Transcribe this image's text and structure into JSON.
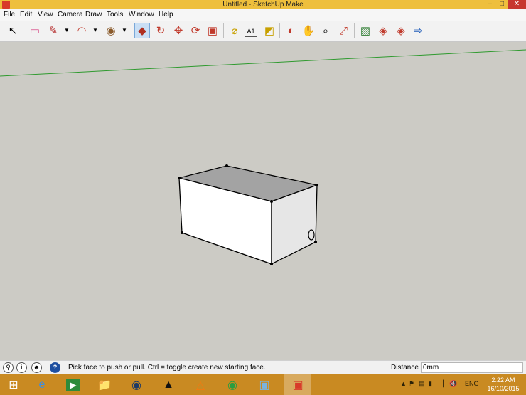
{
  "window": {
    "title": "Untitled - SketchUp Make",
    "minimize": "–",
    "maximize": "□",
    "close": "✕"
  },
  "menu": [
    "File",
    "Edit",
    "View",
    "Camera",
    "Draw",
    "Tools",
    "Window",
    "Help"
  ],
  "toolbar": {
    "tools": [
      {
        "icon": "select-arrow-icon",
        "glyph": "↖"
      },
      {
        "icon": "eraser-icon",
        "glyph": "▭"
      },
      {
        "icon": "pencil-line-icon",
        "glyph": "✎"
      },
      {
        "icon": "arc-icon",
        "glyph": "◠"
      },
      {
        "icon": "shape-circle-icon",
        "glyph": "◉"
      },
      {
        "icon": "push-pull-icon",
        "glyph": "◆"
      },
      {
        "icon": "follow-me-icon",
        "glyph": "↻"
      },
      {
        "icon": "move-icon",
        "glyph": "✥"
      },
      {
        "icon": "rotate-icon",
        "glyph": "⟳"
      },
      {
        "icon": "scale-icon",
        "glyph": "▣"
      },
      {
        "icon": "tape-measure-icon",
        "glyph": "⌀"
      },
      {
        "icon": "text-label-icon",
        "glyph": "A1"
      },
      {
        "icon": "paint-bucket-icon",
        "glyph": "◩"
      },
      {
        "icon": "orbit-icon",
        "glyph": "◐"
      },
      {
        "icon": "pan-hand-icon",
        "glyph": "✋"
      },
      {
        "icon": "zoom-icon",
        "glyph": "⌕"
      },
      {
        "icon": "zoom-extents-icon",
        "glyph": "⤢"
      },
      {
        "icon": "add-location-icon",
        "glyph": "▧"
      },
      {
        "icon": "3d-warehouse-icon",
        "glyph": "◈"
      },
      {
        "icon": "extension-warehouse-icon",
        "glyph": "◈"
      },
      {
        "icon": "share-model-icon",
        "glyph": "⇨"
      }
    ]
  },
  "status": {
    "hint": "Pick face to push or pull.  Ctrl = toggle create new starting face.",
    "distance_label": "Distance",
    "distance_value": "0mm"
  },
  "taskbar": {
    "apps": [
      {
        "icon": "windows-start-icon"
      },
      {
        "icon": "internet-explorer-icon"
      },
      {
        "icon": "xbox-games-icon"
      },
      {
        "icon": "file-explorer-icon"
      },
      {
        "icon": "app-compass-icon"
      },
      {
        "icon": "inkscape-icon"
      },
      {
        "icon": "vlc-icon"
      },
      {
        "icon": "chrome-icon"
      },
      {
        "icon": "photo-viewer-icon"
      },
      {
        "icon": "sketchup-icon"
      }
    ],
    "language": "ENG",
    "time": "2:22 AM",
    "date": "16/10/2015"
  },
  "colors": {
    "titlebar": "#eebf3c",
    "viewport": "#cccbc5",
    "taskbar": "#c98a22",
    "horizon": "#2e9a2e"
  }
}
